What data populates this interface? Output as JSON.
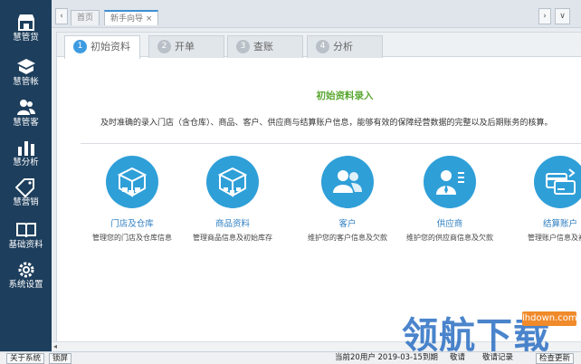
{
  "sidebar": {
    "items": [
      {
        "label": "慧管货"
      },
      {
        "label": "慧管帐"
      },
      {
        "label": "慧管客"
      },
      {
        "label": "慧分析"
      },
      {
        "label": "慧营销"
      },
      {
        "label": "基础资料"
      },
      {
        "label": "系统设置"
      }
    ]
  },
  "tabs": {
    "items": [
      {
        "label": "首页"
      },
      {
        "label": "新手向导 ×"
      }
    ],
    "left_arrow": "‹",
    "right_arrow": "›",
    "dropdown": "∨"
  },
  "steps": [
    {
      "num": "1",
      "label": "初始资料"
    },
    {
      "num": "2",
      "label": "开单"
    },
    {
      "num": "3",
      "label": "查账"
    },
    {
      "num": "4",
      "label": "分析"
    }
  ],
  "content": {
    "title": "初始资料录入",
    "description": "及时准确的录入门店（含仓库）、商品、客户、供应商与结算账户信息，能够有效的保障经营数据的完整以及后期账务的核算。"
  },
  "cards": [
    {
      "name": "门店及仓库",
      "desc": "管理您的门店及仓库信息",
      "icon": "warehouse-icon"
    },
    {
      "name": "商品资料",
      "desc": "管理商品信息及初始库存",
      "icon": "goods-icon"
    },
    {
      "name": "客户",
      "desc": "维护您的客户信息及欠款",
      "icon": "customers-icon"
    },
    {
      "name": "供应商",
      "desc": "维护您的供应商信息及欠款",
      "icon": "supplier-icon"
    },
    {
      "name": "结算账户",
      "desc": "管理账户信息及初始",
      "icon": "account-icon"
    }
  ],
  "statusbar": {
    "about": "关于系统",
    "lock": "锁屏",
    "expire": "当前20用户 2019-03-15到期",
    "hint1": "敬请",
    "hint2": "敬请记录",
    "check": "检查更新"
  },
  "watermark": {
    "text": "领航下载",
    "site": "lhdown.com"
  },
  "colors": {
    "sidebar": "#1d3e5c",
    "accent": "#2f9fd8",
    "title_green": "#5aa832"
  }
}
